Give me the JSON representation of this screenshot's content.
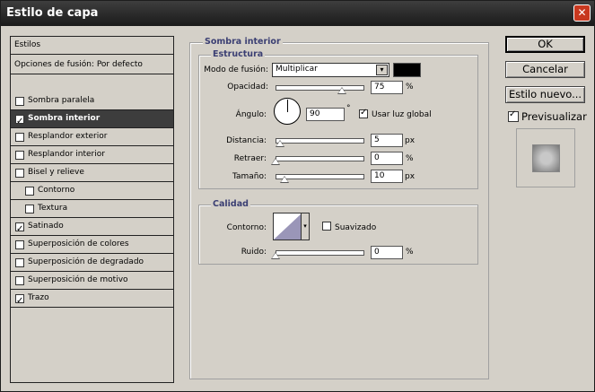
{
  "window": {
    "title": "Estilo de capa",
    "close_glyph": "✕"
  },
  "styles_list": {
    "header": "Estilos",
    "blend_options": "Opciones de fusión: Por defecto",
    "items": [
      {
        "label": "Sombra paralela",
        "checked": false
      },
      {
        "label": "Sombra interior",
        "checked": true,
        "selected": true
      },
      {
        "label": "Resplandor exterior",
        "checked": false
      },
      {
        "label": "Resplandor interior",
        "checked": false
      },
      {
        "label": "Bisel y relieve",
        "checked": false
      },
      {
        "label": "Contorno",
        "checked": false,
        "indent": true
      },
      {
        "label": "Textura",
        "checked": false,
        "indent": true
      },
      {
        "label": "Satinado",
        "checked": true
      },
      {
        "label": "Superposición de colores",
        "checked": false
      },
      {
        "label": "Superposición de degradado",
        "checked": false
      },
      {
        "label": "Superposición de motivo",
        "checked": false
      },
      {
        "label": "Trazo",
        "checked": true
      }
    ]
  },
  "inner_shadow": {
    "section_title": "Sombra interior",
    "structure": {
      "title": "Estructura",
      "blend_mode_label": "Modo de fusión:",
      "blend_mode_value": "Multiplicar",
      "shadow_color": "#000000",
      "opacity_label": "Opacidad:",
      "opacity_value": "75",
      "opacity_unit": "%",
      "angle_label": "Ángulo:",
      "angle_value": "90",
      "angle_unit": "°",
      "global_light_label": "Usar luz global",
      "global_light_checked": true,
      "distance_label": "Distancia:",
      "distance_value": "5",
      "distance_unit": "px",
      "choke_label": "Retraer:",
      "choke_value": "0",
      "choke_unit": "%",
      "size_label": "Tamaño:",
      "size_value": "10",
      "size_unit": "px"
    },
    "quality": {
      "title": "Calidad",
      "contour_label": "Contorno:",
      "antialias_label": "Suavizado",
      "antialias_checked": false,
      "noise_label": "Ruido:",
      "noise_value": "0",
      "noise_unit": "%"
    }
  },
  "buttons": {
    "ok": "OK",
    "cancel": "Cancelar",
    "new_style": "Estilo nuevo...",
    "preview_label": "Previsualizar",
    "preview_checked": true
  }
}
